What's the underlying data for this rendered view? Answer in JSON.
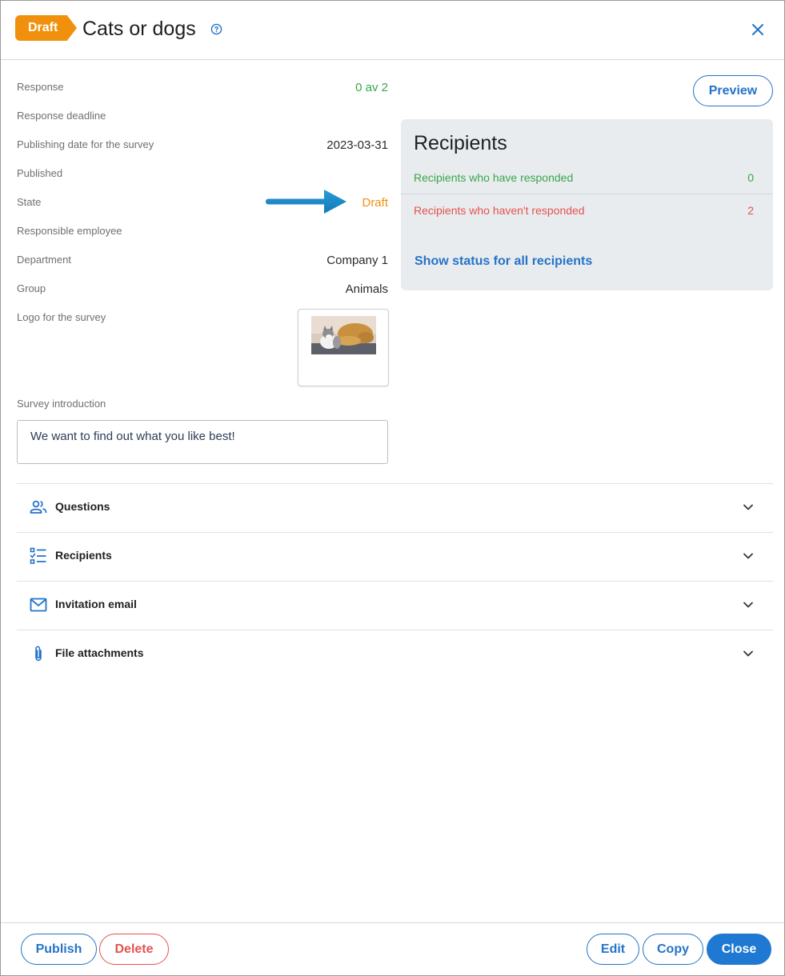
{
  "header": {
    "status_tag": "Draft",
    "title": "Cats or dogs",
    "help_icon": "help-circle-icon",
    "close_icon": "close-icon"
  },
  "details": [
    {
      "label": "Response",
      "value": "0 av 2",
      "color": "#3aa64a"
    },
    {
      "label": "Response deadline",
      "value": ""
    },
    {
      "label": "Publishing date for the survey",
      "value": "2023-03-31"
    },
    {
      "label": "Published",
      "value": ""
    },
    {
      "label": "State",
      "value": "Draft",
      "color": "#f0900c"
    },
    {
      "label": "Responsible employee",
      "value": ""
    },
    {
      "label": "Department",
      "value": "Company 1"
    },
    {
      "label": "Group",
      "value": "Animals"
    },
    {
      "label": "Logo for the survey",
      "value": ""
    }
  ],
  "intro": {
    "label": "Survey introduction",
    "text": "We want to find out what you like best!"
  },
  "preview_button": "Preview",
  "recipients_panel": {
    "title": "Recipients",
    "responded_label": "Recipients who have responded",
    "responded_count": "0",
    "not_responded_label": "Recipients who haven't responded",
    "not_responded_count": "2",
    "show_status_link": "Show status for all recipients"
  },
  "accordion": [
    {
      "label": "Questions",
      "icon": "people-icon"
    },
    {
      "label": "Recipients",
      "icon": "checklist-icon"
    },
    {
      "label": "Invitation email",
      "icon": "envelope-icon"
    },
    {
      "label": "File attachments",
      "icon": "paperclip-icon"
    }
  ],
  "footer": {
    "publish": "Publish",
    "delete": "Delete",
    "edit": "Edit",
    "copy": "Copy",
    "close": "Close"
  },
  "colors": {
    "accent": "#2473c8",
    "draft_orange": "#f0900c",
    "success_green": "#3aa64a",
    "danger_red": "#e3534f"
  }
}
